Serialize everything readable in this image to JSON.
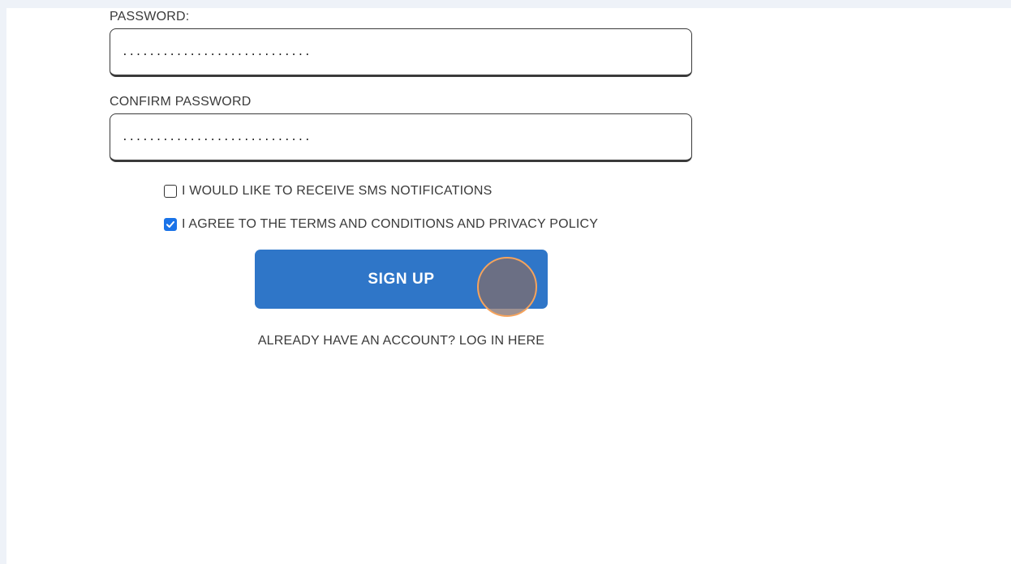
{
  "form": {
    "password_label": "PASSWORD:",
    "password_value": "............................",
    "confirm_label": "CONFIRM PASSWORD",
    "confirm_value": "............................",
    "sms_label": "I WOULD LIKE TO RECEIVE SMS NOTIFICATIONS",
    "sms_checked": false,
    "terms_label": "I AGREE TO THE TERMS AND CONDITIONS AND PRIVACY POLICY",
    "terms_checked": true,
    "signup_label": "SIGN UP",
    "login_link": "ALREADY HAVE AN ACCOUNT? LOG IN HERE"
  },
  "colors": {
    "accent": "#2f76c8",
    "checkbox_checked": "#1a73e8",
    "cursor_ring": "#f5a35c"
  }
}
